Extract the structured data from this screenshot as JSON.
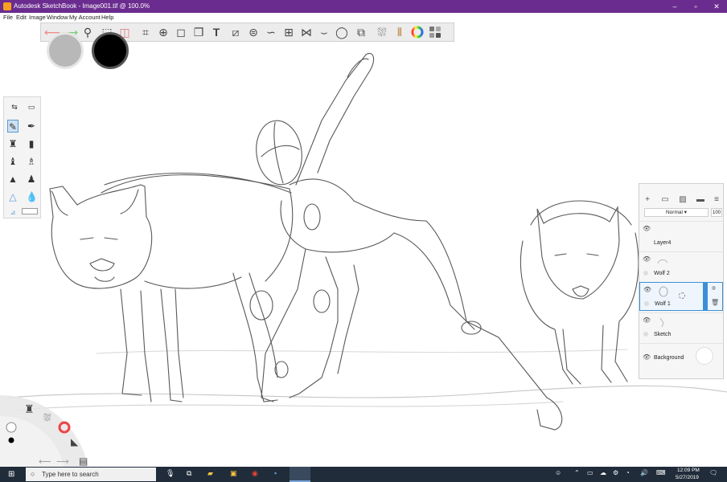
{
  "window": {
    "title": "Autodesk SketchBook - Image001.tif @ 100.0%",
    "controls": [
      "–",
      "▫",
      "✕"
    ]
  },
  "menu": [
    "File",
    "Edit",
    "Image",
    "Window",
    "My Account",
    "Help"
  ],
  "toolbar": {
    "tools": [
      "undo-icon",
      "redo-icon",
      "zoom-icon",
      "select-icon",
      "crop-shape-icon",
      "crop-icon",
      "lasso-icon",
      "distort-icon",
      "flipbook-icon",
      "text-icon",
      "ruler-icon",
      "ellipse-guide-icon",
      "french-curve-icon",
      "perspective-icon",
      "symmetry-icon",
      "curve-icon",
      "ellipse-icon",
      "shape-icon",
      "fill-icon",
      "copic-icon",
      "color-wheel-icon",
      "color-grid-icon"
    ],
    "accent": "#6b2c8f"
  },
  "colors": {
    "secondary": "#c8c8c8",
    "primary": "#000000"
  },
  "layers": {
    "blend_mode": "Normal",
    "opacity": "100",
    "items": [
      {
        "name": "Layer4"
      },
      {
        "name": "Wolf 2"
      },
      {
        "name": "Wolf 1"
      },
      {
        "name": "Sketch"
      },
      {
        "name": "Background"
      }
    ]
  },
  "taskbar": {
    "search_placeholder": "Type here to search",
    "time": "12:09 PM",
    "date": "5/27/2019"
  }
}
